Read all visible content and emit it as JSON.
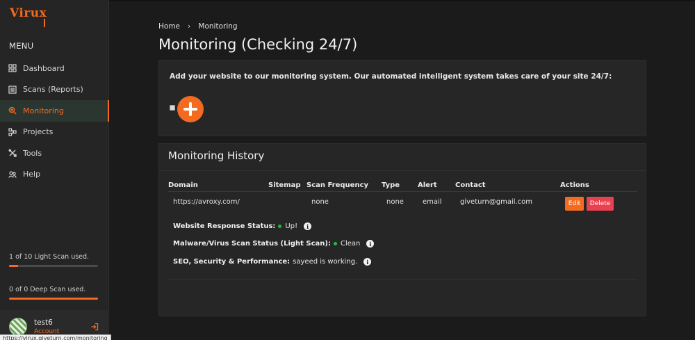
{
  "sidebar": {
    "logo": "Virux",
    "menu_title": "MENU",
    "items": [
      {
        "label": "Dashboard",
        "icon": "grid-icon"
      },
      {
        "label": "Scans (Reports)",
        "icon": "list-icon"
      },
      {
        "label": "Monitoring",
        "icon": "monitor-search-icon",
        "active": true
      },
      {
        "label": "Projects",
        "icon": "projects-icon"
      },
      {
        "label": "Tools",
        "icon": "tools-icon"
      },
      {
        "label": "Help",
        "icon": "help-people-icon"
      }
    ],
    "usage_light": {
      "label": "1 of 10 Light Scan used.",
      "fraction": 0.1
    },
    "usage_deep": {
      "label": "0 of 0 Deep Scan used.",
      "fraction": 1.0
    },
    "user": {
      "name": "test6",
      "role": "Account"
    }
  },
  "breadcrumb": {
    "home": "Home",
    "current": "Monitoring"
  },
  "page": {
    "title": "Monitoring (Checking 24/7)"
  },
  "add_card": {
    "text": "Add your website to our monitoring system. Our automated intelligent system takes care of your site 24/7:"
  },
  "history": {
    "title": "Monitoring History",
    "columns": [
      "Domain",
      "Sitemap",
      "Scan Frequency",
      "Type",
      "Alert",
      "Contact",
      "Actions"
    ],
    "rows": [
      {
        "domain": "https://avroxy.com/",
        "sitemap": "",
        "frequency": "none",
        "type": "none",
        "alert": "email",
        "contact": "giveturn@gmail.com",
        "edit_label": "Edit",
        "delete_label": "Delete"
      }
    ],
    "statuses": [
      {
        "label": "Website Response Status:",
        "value": "Up!",
        "dot": true
      },
      {
        "label": "Malware/Virus Scan Status (Light Scan):",
        "value": "Clean",
        "dot": true
      },
      {
        "label": "SEO, Security & Performance:",
        "value": "sayeed is working.",
        "dot": false
      }
    ]
  },
  "status_url": "https://virux.giveturn.com/monitoring",
  "colors": {
    "accent": "#f26b21",
    "danger": "#e8414f",
    "ok": "#1fbf3a"
  }
}
